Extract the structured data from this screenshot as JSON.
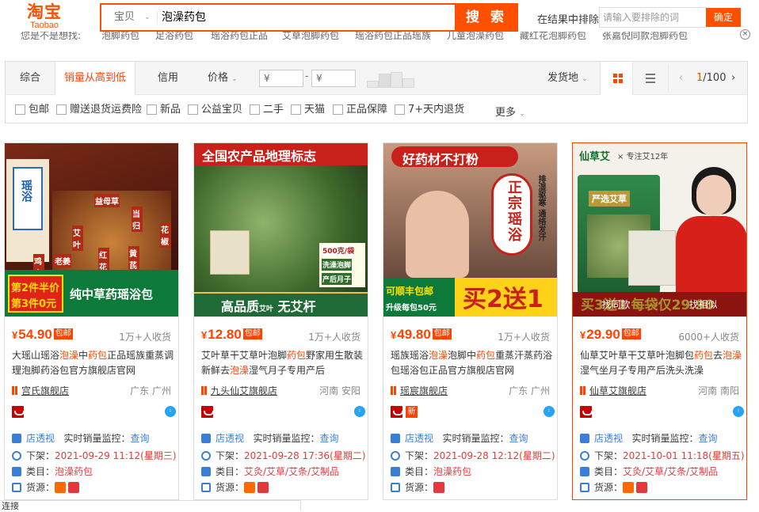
{
  "header": {
    "logo_cn": "淘宝",
    "logo_en": "Taobao",
    "search_type": "宝贝",
    "search_query": "泡澡药包",
    "search_button": "搜 索",
    "exclude_label": "在结果中排除",
    "exclude_placeholder": "请输入要排除的词",
    "exclude_button": "确定",
    "close_symbol": "×"
  },
  "suggestions": [
    "您是不是想找:",
    "泡脚药包",
    "足浴药包",
    "瑶浴药包正品",
    "艾草泡脚药包",
    "瑶浴药包正品瑶族",
    "儿童泡澡药包",
    "藏红花泡脚药包",
    "张嘉倪同款泡脚药包"
  ],
  "sortbar": {
    "tabs": [
      "综合",
      "销量从高到低",
      "信用",
      "价格"
    ],
    "active_tab": 1,
    "price_min_placeholder": "¥",
    "price_max_placeholder": "¥",
    "price_dash": "-",
    "ship_from": "发货地",
    "page_current": "1",
    "page_total": "/100"
  },
  "filters": [
    "包邮",
    "赠送退货运费险",
    "新品",
    "公益宝贝",
    "二手",
    "天猫",
    "正品保障",
    "7+天内退货"
  ],
  "filters_more": "更多",
  "products": [
    {
      "price": "54.90",
      "baoyou": "包邮",
      "sales": "1万+人收货",
      "title_parts": [
        "大瑶山瑶浴",
        "泡澡",
        "中",
        "药包",
        "正品瑶族重蒸调理泡脚药浴包官方旗舰店官网"
      ],
      "shop": "宫氏旗舰店",
      "location": "广东 广州",
      "has_new": false,
      "store_label": "店透视",
      "monitor_label": "实时销量监控：",
      "monitor_link": "查询",
      "offshelf_label": "下架：",
      "offshelf_time": "2021-09-29 11:12(星期三)",
      "category_label": "类目：",
      "category": "泡澡药包",
      "source_label": "货源：",
      "image": {
        "banner1": "第2件半价",
        "banner2": "第3件0元",
        "banner3": "纯中草药瑶浴包",
        "vertical": "瑶浴",
        "herbs": [
          "益母草",
          "艾叶",
          "当归",
          "鸡血藤",
          "花椒",
          "红花",
          "老姜",
          "黄芪"
        ]
      }
    },
    {
      "price": "12.80",
      "baoyou": "包邮",
      "sales": "1万+人收货",
      "title_parts": [
        "艾叶草干艾草叶泡脚",
        "药包",
        "野家用生散装新鲜去",
        "泡澡",
        "湿气月子专用产后"
      ],
      "shop": "九头仙艾旗舰店",
      "location": "河南 安阳",
      "has_new": false,
      "store_label": "店透视",
      "monitor_label": "实时销量监控：",
      "monitor_link": "查询",
      "offshelf_label": "下架：",
      "offshelf_time": "2021-09-28 17:36(星期二)",
      "category_label": "类目：",
      "category": "艾灸/艾草/艾条/艾制品",
      "source_label": "货源：",
      "image": {
        "top": "全国农产品地理标志",
        "tags": [
          "500克/袋",
          "洗澡泡脚",
          "产后月子"
        ],
        "bottom1": "高品质",
        "bottom_small": "艾叶",
        "bottom2": "无艾杆"
      }
    },
    {
      "price": "49.80",
      "baoyou": "包邮",
      "sales": "1万+人收货",
      "title_parts": [
        "瑶族瑶浴",
        "泡澡",
        "泡脚中",
        "药包",
        "重蒸汗蒸药浴包瑶浴包正品官方旗舰店官网"
      ],
      "shop": "瑶宸旗舰店",
      "location": "广东 广州",
      "has_new": true,
      "new_label": "新",
      "store_label": "店透视",
      "monitor_label": "实时销量监控：",
      "monitor_link": "查询",
      "offshelf_label": "下架：",
      "offshelf_time": "2021-09-28 12:12(星期二)",
      "category_label": "类目：",
      "category": "泡澡药包",
      "source_label": "货源：",
      "image": {
        "top": "好药材不打粉",
        "circle": "正宗瑶浴",
        "side": "排湿驱寒 通络发汗",
        "left1": "可顺丰包邮",
        "left2": "升级每包50元",
        "big": "买2送1"
      }
    },
    {
      "price": "29.90",
      "baoyou": "包邮",
      "sales": "6000+人收货",
      "title_parts": [
        "仙草艾叶草干艾草叶泡脚包",
        "药包",
        "去",
        "泡澡",
        "湿气坐月子专用产后洗头洗澡"
      ],
      "shop": "仙草艾旗舰店",
      "location": "河南 南阳",
      "has_new": false,
      "store_label": "店透视",
      "monitor_label": "实时销量监控：",
      "monitor_link": "查询",
      "offshelf_label": "下架：",
      "offshelf_time": "2021-10-01 11:18(星期五)",
      "category_label": "类目：",
      "category": "艾灸/艾草/艾条/艾制品",
      "source_label": "货源：",
      "image": {
        "brand": "仙草艾",
        "brand_tag": "专注艾12年",
        "pack": "严选艾草",
        "bottom": "买3送1 每袋仅29.90"
      },
      "overlay_left": "找同款",
      "overlay_right": "找相似"
    }
  ],
  "bottom_tip": "连接"
}
